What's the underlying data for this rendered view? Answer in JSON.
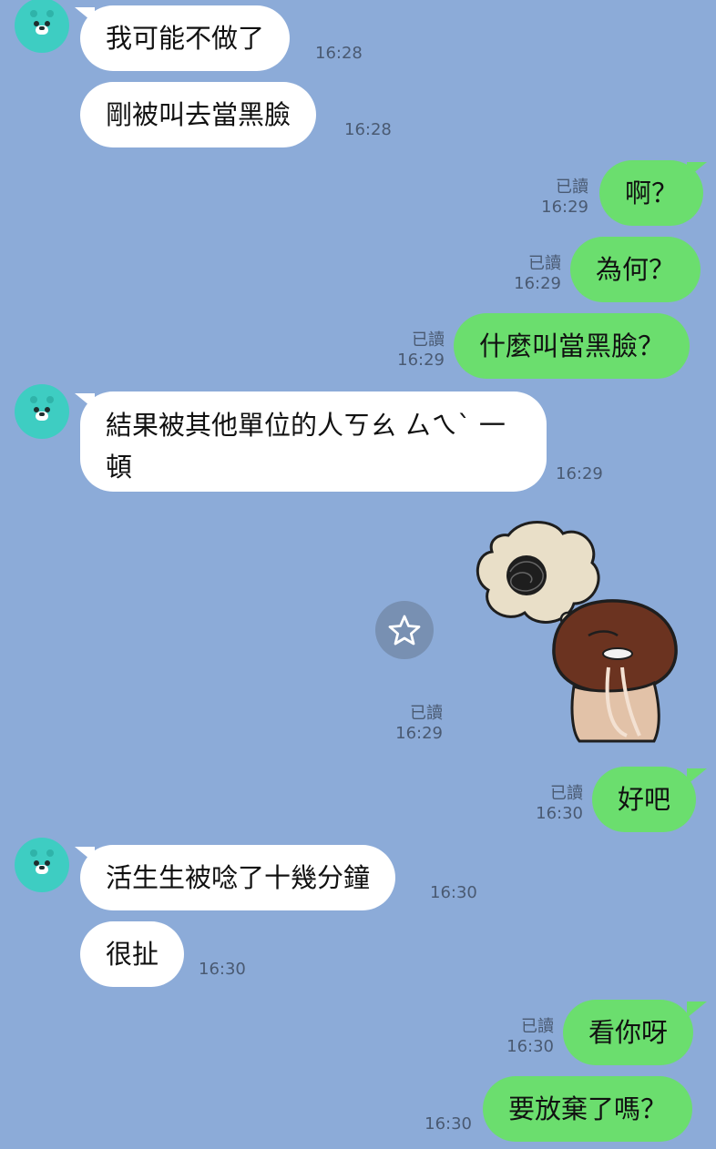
{
  "messages": [
    {
      "side": "in",
      "text": "我可能不做了",
      "time": "16:28"
    },
    {
      "side": "in",
      "text": "剛被叫去當黑臉",
      "time": "16:28"
    },
    {
      "side": "out",
      "text": "啊？",
      "read": "已讀",
      "time": "16:29"
    },
    {
      "side": "out",
      "text": "為何？",
      "read": "已讀",
      "time": "16:29"
    },
    {
      "side": "out",
      "text": "什麼叫當黑臉？",
      "read": "已讀",
      "time": "16:29"
    },
    {
      "side": "in",
      "text": "結果被其他單位的人ㄎㄠ ㄙㄟˋ 一頓",
      "time": "16:29"
    },
    {
      "side": "out",
      "sticker": "mushroom-thinking-sticker",
      "read": "已讀",
      "time": "16:29"
    },
    {
      "side": "out",
      "text": "好吧",
      "read": "已讀",
      "time": "16:30"
    },
    {
      "side": "in",
      "text": "活生生被唸了十幾分鐘",
      "time": "16:30"
    },
    {
      "side": "in",
      "text": "很扯",
      "time": "16:30"
    },
    {
      "side": "out",
      "text": "看你呀",
      "read": "已讀",
      "time": "16:30"
    },
    {
      "side": "out",
      "text": "要放棄了嗎？",
      "time": "16:30"
    }
  ],
  "colors": {
    "background": "#8CABD8",
    "incoming_bubble": "#ffffff",
    "outgoing_bubble": "#6BDE6E",
    "avatar": "#3ECDC2"
  },
  "icons": {
    "favorite": "star-icon",
    "avatar": "bear-avatar-icon"
  }
}
